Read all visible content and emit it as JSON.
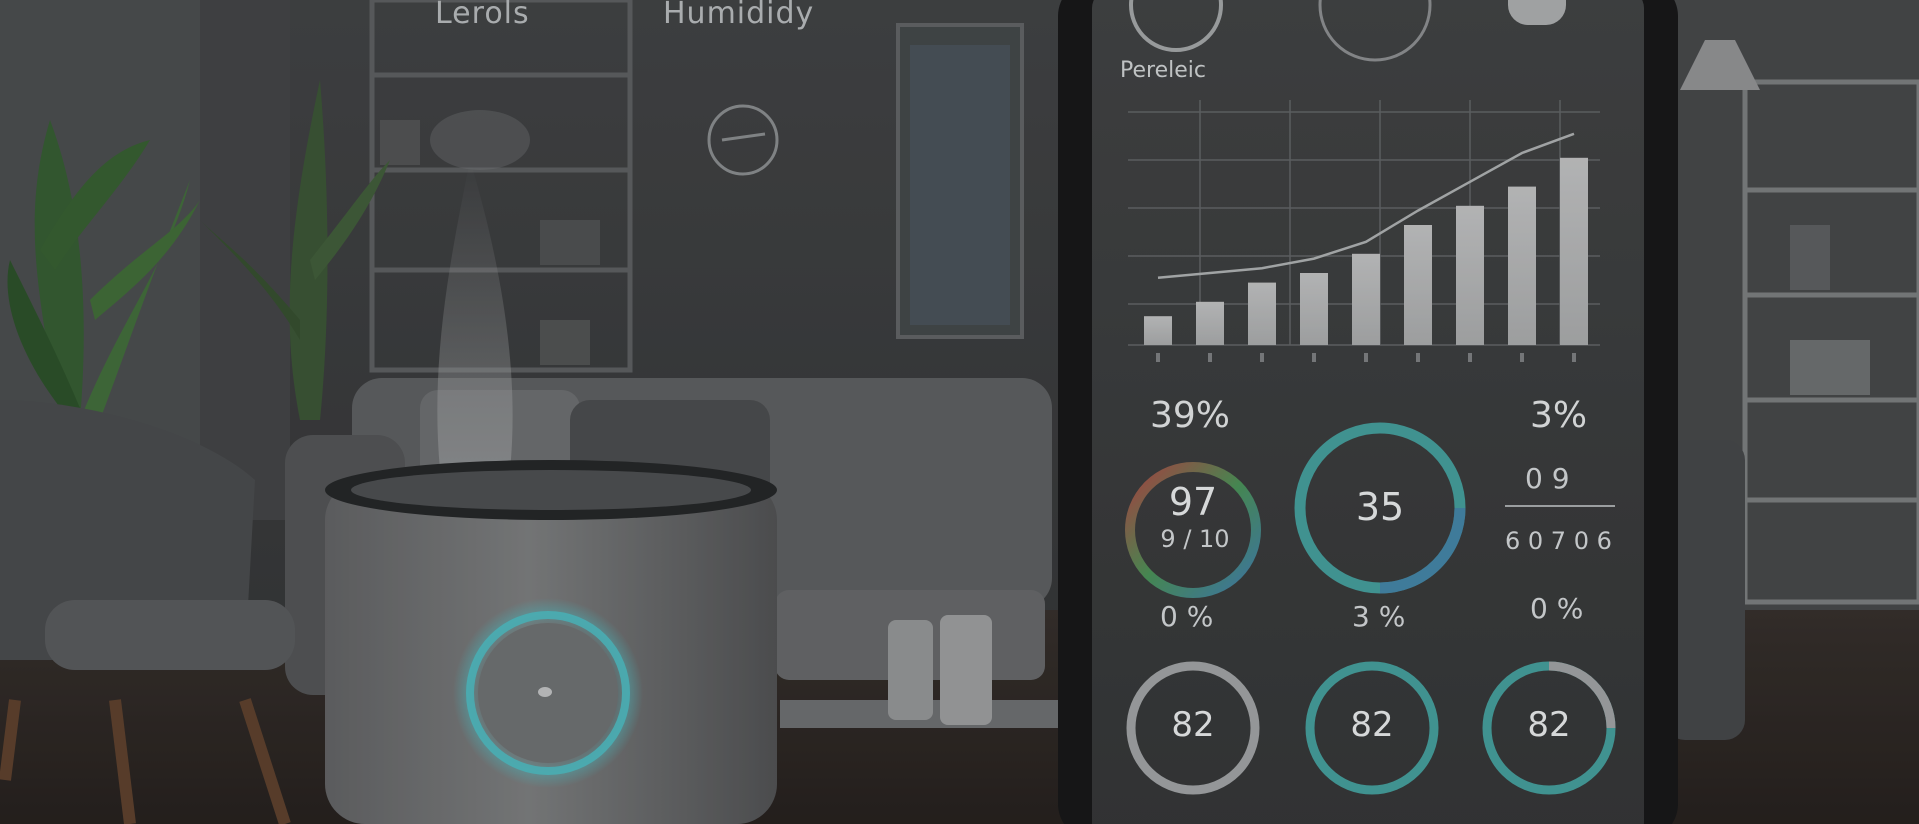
{
  "overlay": {
    "label_left": "Lerols",
    "label_right": "Humididy",
    "chart_title": "Pereleic"
  },
  "chart_data": {
    "type": "bar",
    "categories": [
      "",
      "",
      "",
      "",
      "",
      "",
      "",
      "",
      ""
    ],
    "values": [
      12,
      18,
      26,
      30,
      38,
      50,
      58,
      66,
      78
    ],
    "ylim": [
      0,
      100
    ],
    "grid": true,
    "trend_line": [
      28,
      30,
      32,
      36,
      43,
      56,
      68,
      80,
      88
    ]
  },
  "stats": {
    "left_pct": "39%",
    "right_pct": "3%",
    "ring_left_value": "97",
    "ring_left_sub": "9 / 10",
    "ring_center_value": "35",
    "right_value": "0 9",
    "right_sub": "6 0 7 0 6",
    "row_pct_1": "0 %",
    "row_pct_2": "3 %",
    "row_pct_3": "0 %",
    "gauge_1": "82",
    "gauge_2": "82",
    "gauge_3": "82"
  },
  "colors": {
    "ring_teal": "#4fb2b0",
    "ring_red": "#d2574f",
    "ring_green": "#5fae6b",
    "ring_blue": "#4e8fbf",
    "device_glow": "#5ad4da"
  }
}
